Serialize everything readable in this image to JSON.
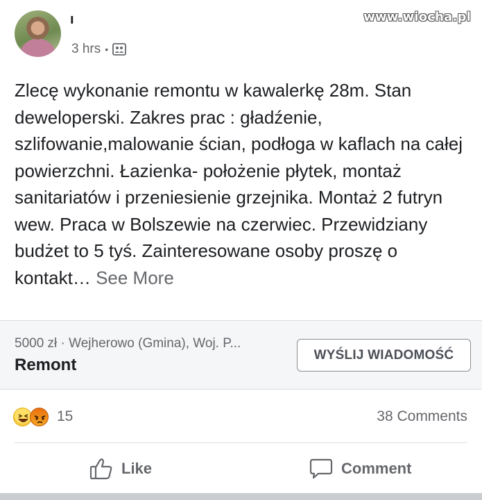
{
  "post": {
    "author_name": "ı",
    "time": "3 hrs",
    "separator": "•",
    "privacy_icon": "public-group-icon",
    "text": "Zlecę wykonanie remontu w kawalerkę 28m. Stan deweloperski. Zakres prac : gładźenie, szlifowanie,malowanie ścian, podłoga w kaflach na całej powierzchni. Łazienka- położenie płytek, montaż sanitariatów i przeniesienie grzejnika. Montaż 2 futryn wew.  Praca w Bolszewie na czerwiec. Przewidziany budżet  to 5 tyś. Zainteresowane osoby proszę o kontakt…",
    "see_more": "See More"
  },
  "watermark": "www.wiocha.pl",
  "listing": {
    "details": "5000 zł · Wejherowo (Gmina), Woj. P...",
    "title": "Remont",
    "button_label": "WYŚLIJ WIADOMOŚĆ"
  },
  "reactions": {
    "icons": [
      "haha-icon",
      "angry-icon"
    ],
    "count": "15",
    "comments": "38 Comments"
  },
  "actions": {
    "like_label": "Like",
    "comment_label": "Comment"
  },
  "colors": {
    "text": "#1c1e21",
    "secondary": "#65676b",
    "listing_bg": "#f5f6f7"
  }
}
